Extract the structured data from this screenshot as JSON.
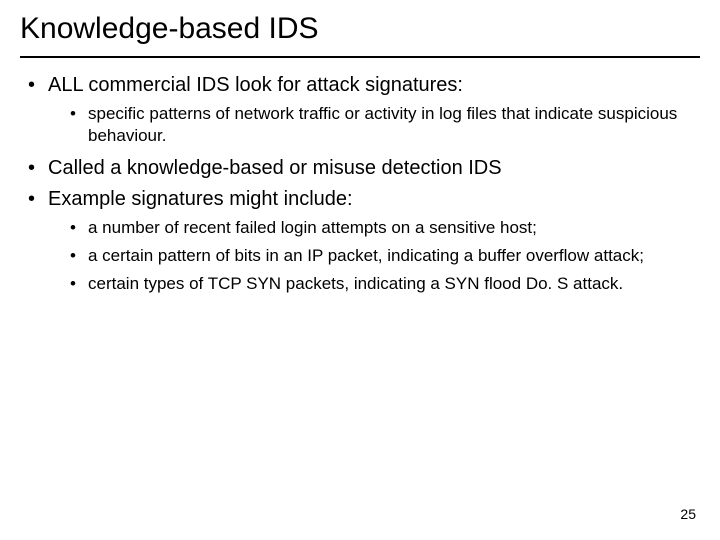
{
  "title": "Knowledge-based IDS",
  "bullets": {
    "b1": "ALL commercial IDS look for attack signatures:",
    "b1_sub": {
      "s1": "specific patterns of network traffic or activity in log files that indicate suspicious behaviour."
    },
    "b2": "Called a knowledge-based or misuse detection IDS",
    "b3": "Example signatures might include:",
    "b3_sub": {
      "s1": "a number of recent failed login attempts on a sensitive host;",
      "s2": "a certain pattern of bits in an IP packet, indicating a buffer overflow attack;",
      "s3": "certain types of TCP SYN packets, indicating a SYN flood Do. S attack."
    }
  },
  "page_number": "25"
}
